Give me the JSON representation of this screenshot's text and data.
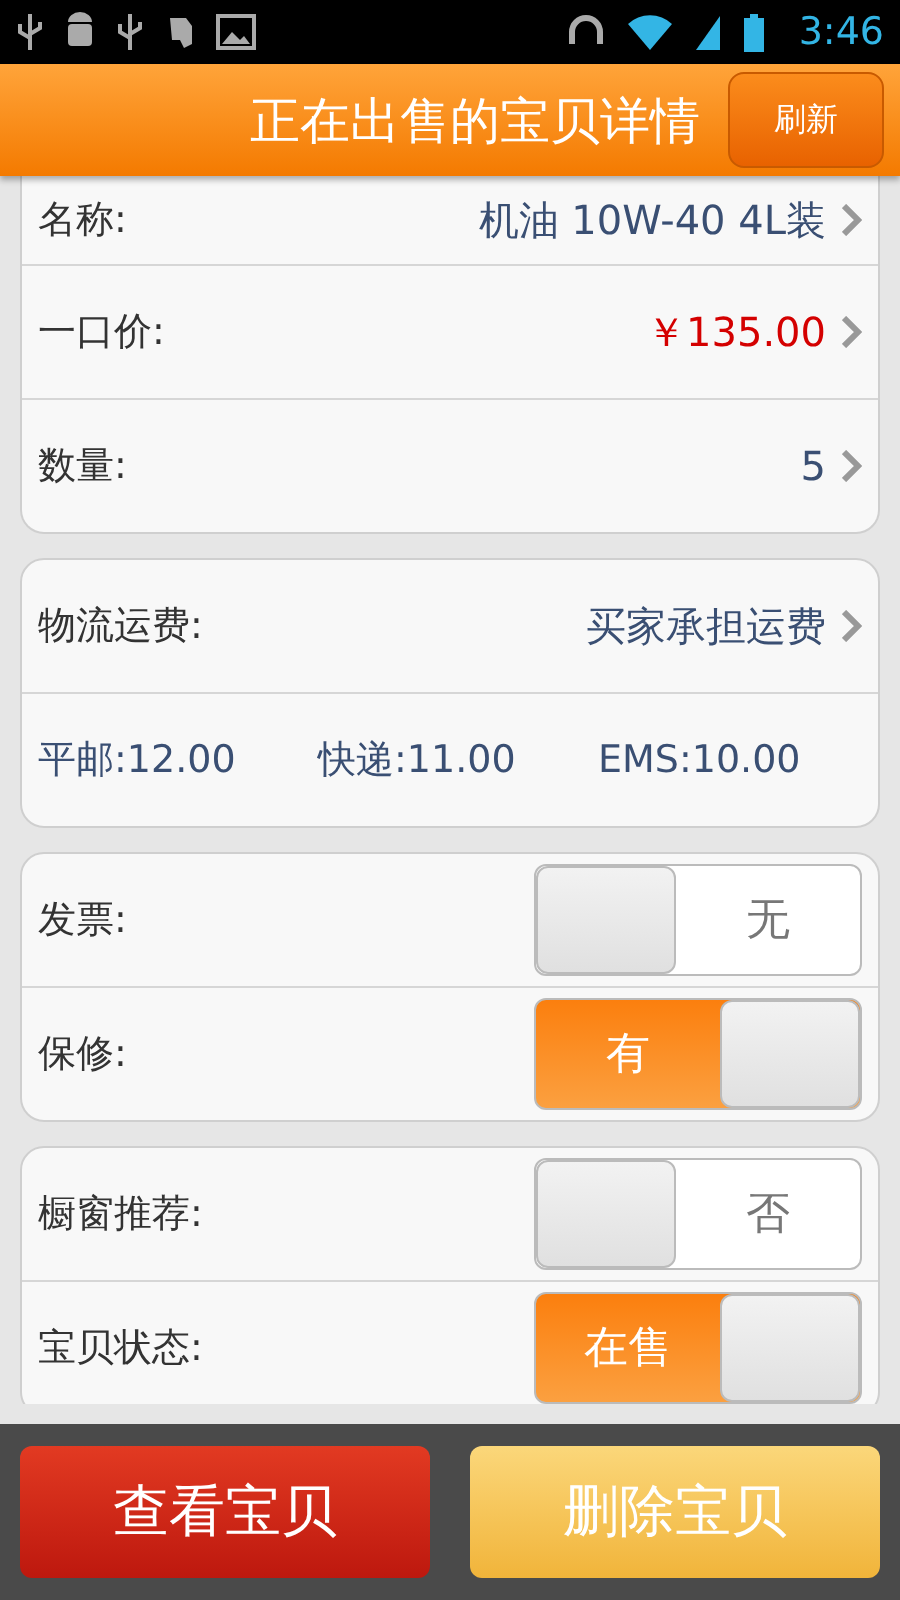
{
  "status_bar": {
    "time": "3:46"
  },
  "header": {
    "title": "正在出售的宝贝详情",
    "refresh_button": "刷新"
  },
  "item_card": [
    {
      "kind": "value",
      "label": "名称:",
      "value": "机油 10W-40 4L装",
      "highlight": false
    },
    {
      "kind": "value",
      "label": "一口价:",
      "value": "￥135.00",
      "highlight": true
    },
    {
      "kind": "value",
      "label": "数量:",
      "value": "5",
      "highlight": false
    }
  ],
  "shipping_card": {
    "label": "物流运费:",
    "value": "买家承担运费",
    "fees": [
      "平邮:12.00",
      "快递:11.00",
      "EMS:10.00"
    ]
  },
  "toggle_cards": [
    [
      {
        "label": "发票:",
        "value": "无",
        "on": false
      },
      {
        "label": "保修:",
        "value": "有",
        "on": true
      }
    ],
    [
      {
        "label": "橱窗推荐:",
        "value": "否",
        "on": false
      },
      {
        "label": "宝贝状态:",
        "value": "在售",
        "on": true
      }
    ]
  ],
  "footer": [
    {
      "kind": "primary",
      "label": "查看宝贝"
    },
    {
      "kind": "secondary",
      "label": "删除宝贝"
    }
  ]
}
